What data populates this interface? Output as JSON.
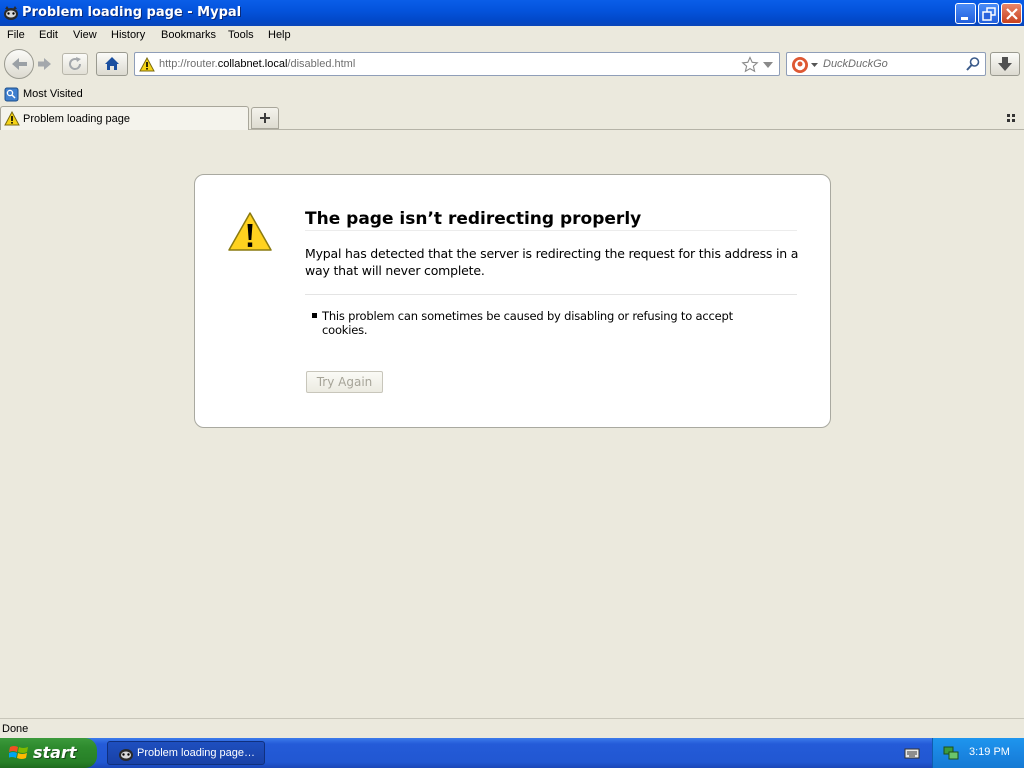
{
  "window": {
    "title": "Problem loading page - Mypal",
    "buttons": [
      "minimize",
      "restore",
      "close"
    ]
  },
  "menu": {
    "items": [
      {
        "label": "File"
      },
      {
        "label": "Edit"
      },
      {
        "label": "View"
      },
      {
        "label": "History"
      },
      {
        "label": "Bookmarks"
      },
      {
        "label": "Tools"
      },
      {
        "label": "Help"
      }
    ]
  },
  "navbar": {
    "url_prefix": "http://router.",
    "url_host": "collabnet.local",
    "url_path": "/disabled.html",
    "search_placeholder": "DuckDuckGo"
  },
  "bookmarks": {
    "items": [
      {
        "label": "Most Visited",
        "icon": "bookmark-folder-icon"
      }
    ]
  },
  "tabs": [
    {
      "label": "Problem loading page",
      "icon": "warning-icon",
      "active": true
    }
  ],
  "error": {
    "title": "The page isn’t redirecting properly",
    "description": "Mypal has detected that the server is redirecting the request for this address in a way that will never complete.",
    "bullets": [
      "This problem can sometimes be caused by disabling or refusing to accept cookies."
    ],
    "button": "Try Again"
  },
  "status": {
    "text": "Done"
  },
  "taskbar": {
    "start_label": "start",
    "tasks": [
      {
        "label": "Problem loading page…"
      }
    ],
    "clock": "3:19 PM"
  },
  "colors": {
    "titlebar": "#0453dc",
    "chrome": "#ebe9dd",
    "start_green": "#2e8b2e",
    "tray_blue": "#1a86e2"
  }
}
